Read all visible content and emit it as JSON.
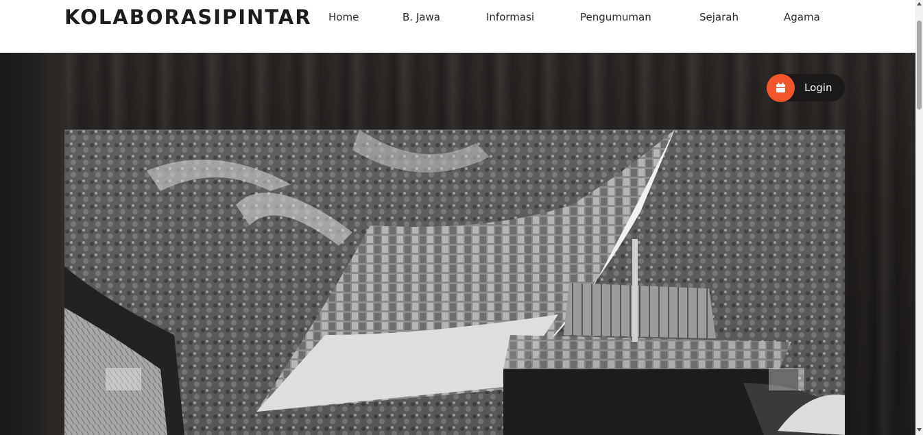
{
  "brand": "KOLABORASIPINTAR",
  "nav": {
    "items": [
      {
        "label": "Home"
      },
      {
        "label": "B. Jawa"
      },
      {
        "label": "Informasi"
      },
      {
        "label": "Pengumuman"
      },
      {
        "label": "Sejarah"
      },
      {
        "label": "Agama"
      }
    ]
  },
  "login": {
    "label": "Login",
    "icon": "calendar-icon"
  },
  "colors": {
    "accent": "#f2552c",
    "nav_text": "#2a2a2a",
    "brand_text": "#1c1c1c",
    "hero_bg": "#252220"
  },
  "slider": {
    "image": "black-and-white photo of a traditional house with curved roof among palm trees"
  }
}
